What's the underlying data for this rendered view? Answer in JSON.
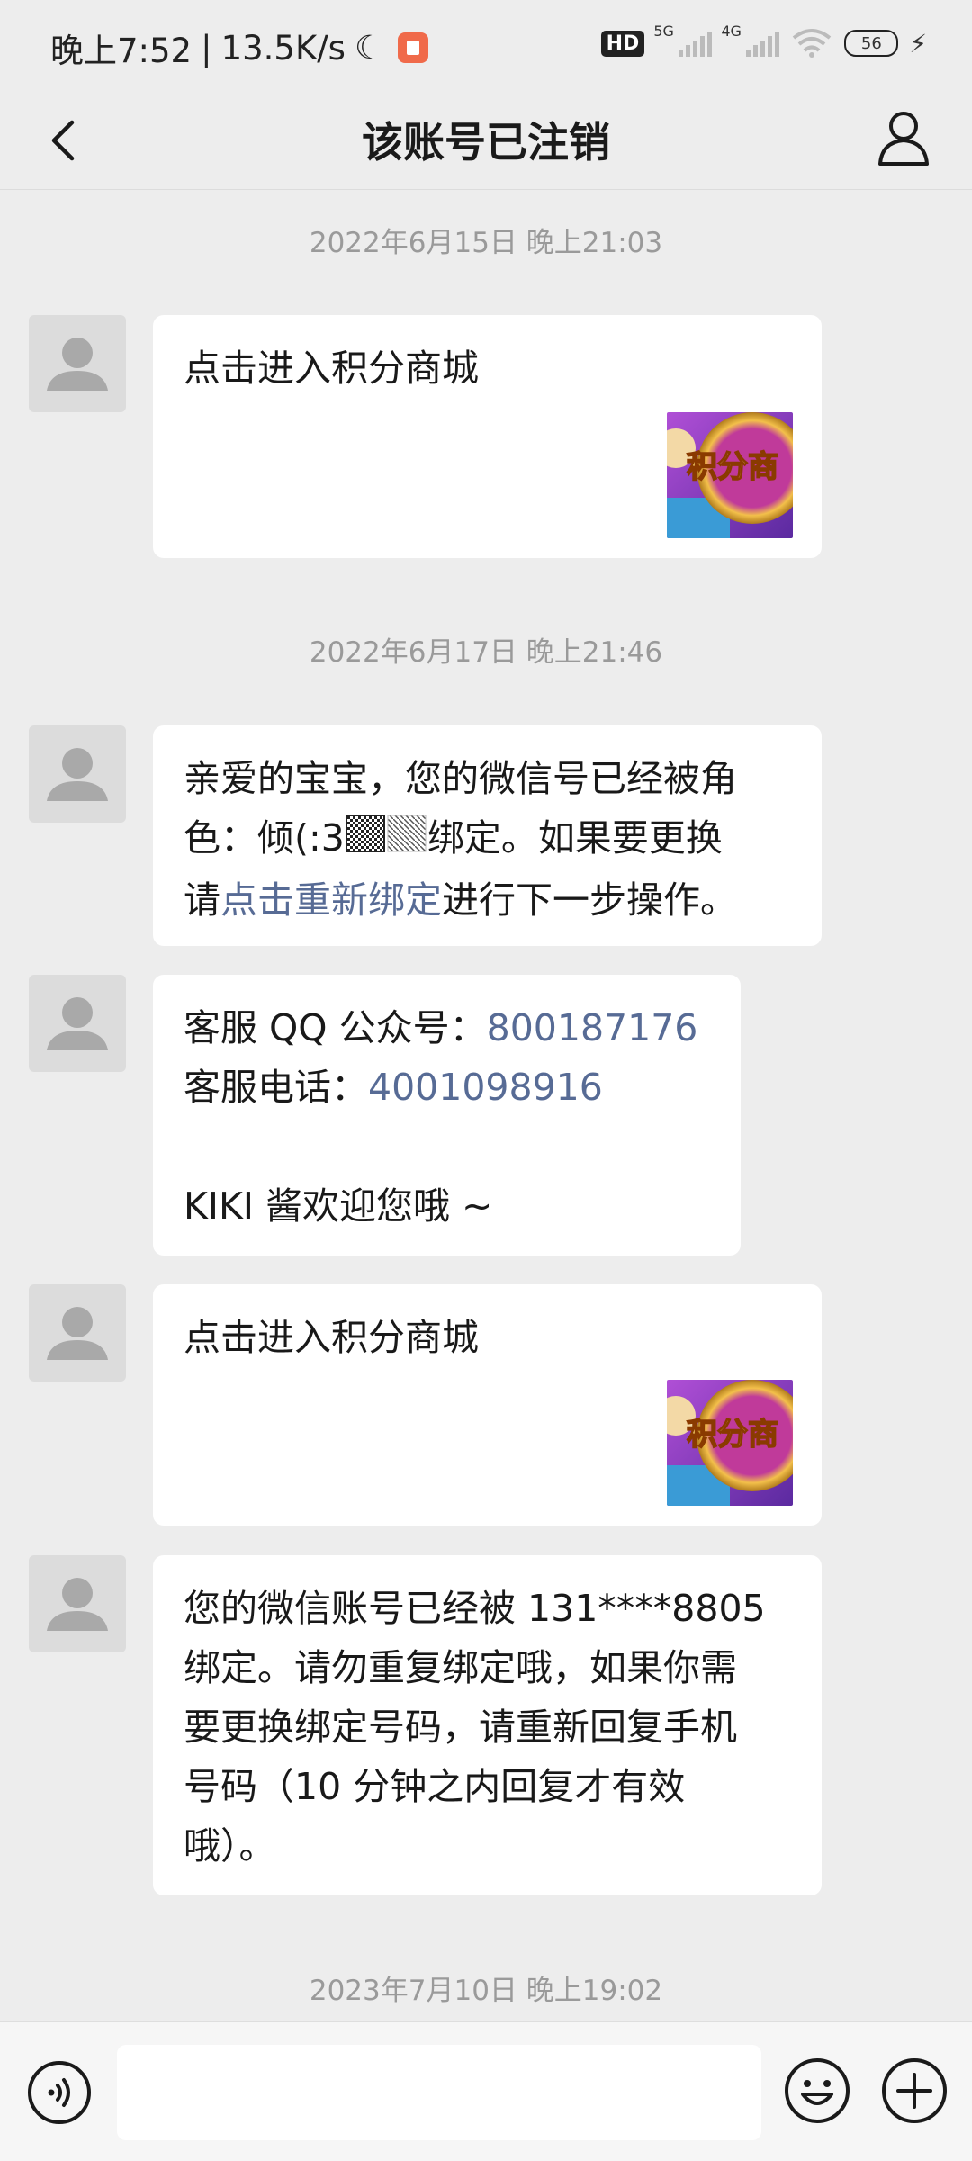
{
  "status_bar": {
    "time": "晚上7:52",
    "net_speed": "13.5K/s",
    "hd_label": "HD",
    "signal1_label": "5G",
    "signal2_label": "4G",
    "battery_level": "56"
  },
  "header": {
    "title": "该账号已注销",
    "back_icon": "chevron-left-icon",
    "profile_icon": "person-outline-icon"
  },
  "messages": [
    {
      "type": "timestamp",
      "text": "2022年6月15日 晚上21:03"
    },
    {
      "type": "card",
      "title": "点击进入积分商城",
      "thumb_label": "积分商"
    },
    {
      "type": "timestamp",
      "text": "2022年6月17日 晚上21:46"
    },
    {
      "type": "text",
      "line1": "亲爱的宝宝，您的微信号已经被角",
      "line2_prefix": "色：倾(:3",
      "line2_suffix": "绑定。如果要更换",
      "line3_prefix": "请",
      "link_text": "点击重新绑定",
      "line3_suffix": "进行下一步操作。"
    },
    {
      "type": "text",
      "qq_label": "客服 QQ 公众号：",
      "qq_number": "800187176",
      "phone_label": "客服电话：",
      "phone_number": "4001098916",
      "welcome": "KIKI 酱欢迎您哦 ~"
    },
    {
      "type": "card",
      "title": "点击进入积分商城",
      "thumb_label": "积分商"
    },
    {
      "type": "text",
      "lines": [
        "您的微信账号已经被 131****8805",
        "绑定。请勿重复绑定哦，如果你需",
        "要更换绑定号码，请重新回复手机",
        "号码（10 分钟之内回复才有效",
        "哦）。"
      ]
    },
    {
      "type": "timestamp",
      "text": "2023年7月10日 晚上19:02"
    }
  ],
  "input_bar": {
    "voice_icon": "voice-icon",
    "text_value": "",
    "emoji_icon": "emoji-icon",
    "plus_icon": "plus-icon"
  },
  "colors": {
    "background": "#ededed",
    "bubble": "#ffffff",
    "link": "#576b95",
    "timestamp": "#9a9a9a"
  }
}
